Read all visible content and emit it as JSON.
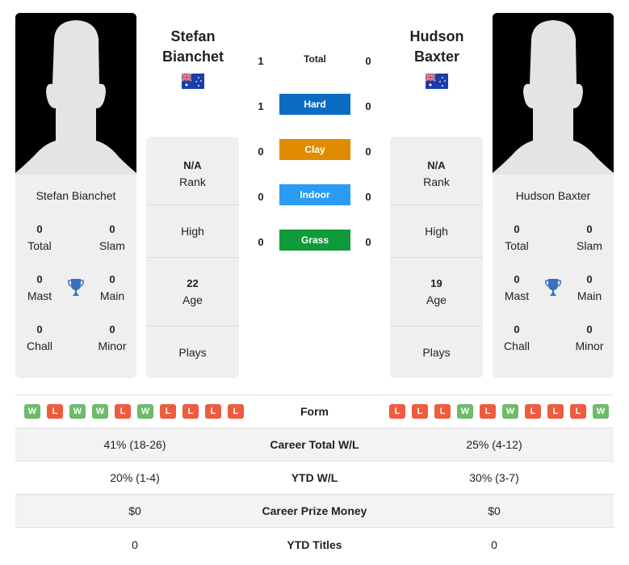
{
  "player1": {
    "name_line1": "Stefan",
    "name_line2": "Bianchet",
    "full_name": "Stefan Bianchet",
    "country_flag": "australia-flag",
    "titles": {
      "total": "0",
      "total_label": "Total",
      "slam": "0",
      "slam_label": "Slam",
      "mast": "0",
      "mast_label": "Mast",
      "main": "0",
      "main_label": "Main",
      "chall": "0",
      "chall_label": "Chall",
      "minor": "0",
      "minor_label": "Minor"
    },
    "rank": "N/A",
    "rank_label": "Rank",
    "high_label": "High",
    "age": "22",
    "age_label": "Age",
    "plays_label": "Plays",
    "form": [
      "W",
      "L",
      "W",
      "W",
      "L",
      "W",
      "L",
      "L",
      "L",
      "L"
    ]
  },
  "player2": {
    "name_line1": "Hudson",
    "name_line2": "Baxter",
    "full_name": "Hudson Baxter",
    "country_flag": "australia-flag",
    "titles": {
      "total": "0",
      "total_label": "Total",
      "slam": "0",
      "slam_label": "Slam",
      "mast": "0",
      "mast_label": "Mast",
      "main": "0",
      "main_label": "Main",
      "chall": "0",
      "chall_label": "Chall",
      "minor": "0",
      "minor_label": "Minor"
    },
    "rank": "N/A",
    "rank_label": "Rank",
    "high_label": "High",
    "age": "19",
    "age_label": "Age",
    "plays_label": "Plays",
    "form": [
      "L",
      "L",
      "L",
      "W",
      "L",
      "W",
      "L",
      "L",
      "L",
      "W"
    ]
  },
  "h2h": [
    {
      "label": "Total",
      "p1": "1",
      "p2": "0",
      "color": ""
    },
    {
      "label": "Hard",
      "p1": "1",
      "p2": "0",
      "color": "#0a6cc0"
    },
    {
      "label": "Clay",
      "p1": "0",
      "p2": "0",
      "color": "#e08b00"
    },
    {
      "label": "Indoor",
      "p1": "0",
      "p2": "0",
      "color": "#2b9bf4"
    },
    {
      "label": "Grass",
      "p1": "0",
      "p2": "0",
      "color": "#119a3a"
    }
  ],
  "stats": {
    "form_label": "Form",
    "rows": [
      {
        "label": "Career Total W/L",
        "p1": "41% (18-26)",
        "p2": "25% (4-12)"
      },
      {
        "label": "YTD W/L",
        "p1": "20% (1-4)",
        "p2": "30% (3-7)"
      },
      {
        "label": "Career Prize Money",
        "p1": "$0",
        "p2": "$0"
      },
      {
        "label": "YTD Titles",
        "p1": "0",
        "p2": "0"
      }
    ]
  },
  "colors": {
    "win": "#6dbb6b",
    "loss": "#ee5b3f",
    "trophy": "#3a6fc4"
  }
}
